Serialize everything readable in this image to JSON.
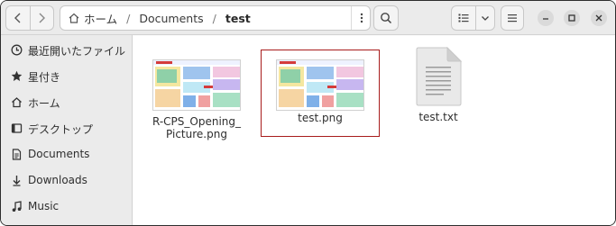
{
  "window": {
    "path": {
      "home_label": "ホーム",
      "segment": "Documents",
      "separator": "/",
      "current": "test"
    }
  },
  "sidebar": {
    "items": [
      {
        "label": "最近開いたファイル",
        "icon": "clock-icon"
      },
      {
        "label": "星付き",
        "icon": "star-icon"
      },
      {
        "label": "ホーム",
        "icon": "home-icon"
      },
      {
        "label": "デスクトップ",
        "icon": "desktop-icon"
      },
      {
        "label": "Documents",
        "icon": "document-icon"
      },
      {
        "label": "Downloads",
        "icon": "download-icon"
      },
      {
        "label": "Music",
        "icon": "music-icon"
      }
    ]
  },
  "files": [
    {
      "name_line1": "R-CPS_Opening_",
      "name_line2": "Picture.png",
      "type": "image",
      "selected": false
    },
    {
      "name": "test.png",
      "type": "image",
      "selected": true
    },
    {
      "name": "test.txt",
      "type": "text",
      "selected": false
    }
  ],
  "colors": {
    "selection_border": "#a81c1c",
    "header_bg": "#ebebeb",
    "sidebar_bg": "#ebebeb",
    "content_bg": "#ffffff"
  }
}
